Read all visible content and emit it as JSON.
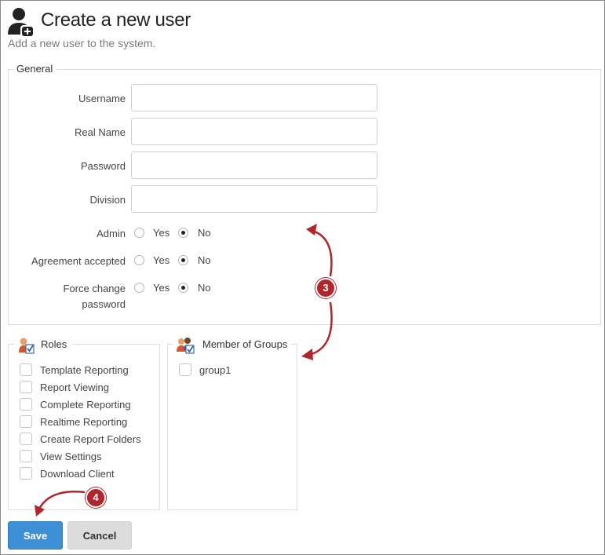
{
  "header": {
    "title": "Create a new user",
    "subtitle": "Add a new user to the system."
  },
  "general": {
    "legend": "General",
    "fields": [
      {
        "label": "Username",
        "value": ""
      },
      {
        "label": "Real Name",
        "value": ""
      },
      {
        "label": "Password",
        "value": ""
      },
      {
        "label": "Division",
        "value": ""
      }
    ],
    "radios": [
      {
        "label": "Admin",
        "yes": "Yes",
        "no": "No",
        "selected": "No"
      },
      {
        "label": "Agreement accepted",
        "yes": "Yes",
        "no": "No",
        "selected": "No"
      },
      {
        "label_line1": "Force change",
        "label_line2": "password",
        "yes": "Yes",
        "no": "No",
        "selected": "No"
      }
    ]
  },
  "roles": {
    "legend": "Roles",
    "items": [
      "Template Reporting",
      "Report Viewing",
      "Complete Reporting",
      "Realtime Reporting",
      "Create Report Folders",
      "View Settings",
      "Download Client"
    ]
  },
  "groups": {
    "legend": "Member of Groups",
    "items": [
      "group1"
    ]
  },
  "buttons": {
    "save": "Save",
    "cancel": "Cancel"
  },
  "annotations": {
    "step3": "3",
    "step4": "4"
  }
}
